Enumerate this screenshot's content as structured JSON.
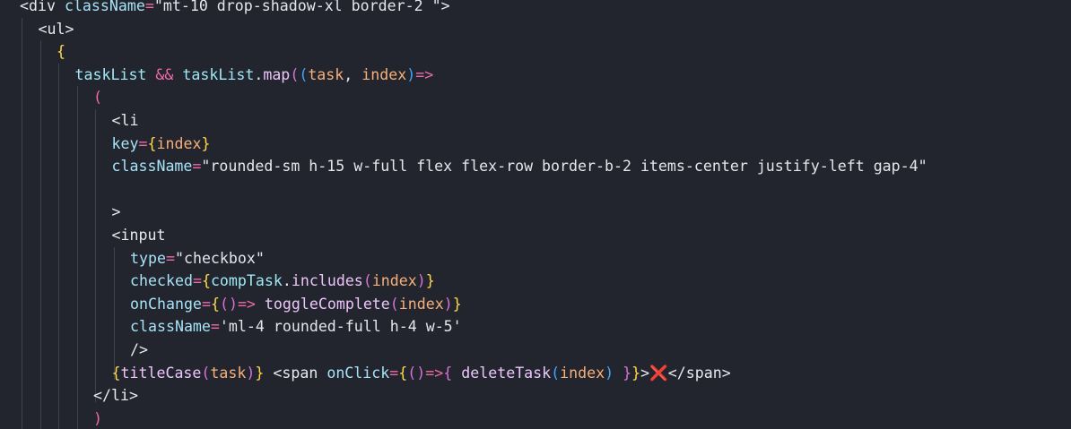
{
  "editor": {
    "colors": {
      "background": "#22252e",
      "default": "#e7e9ee",
      "tag": "#e7e9ee",
      "attr": "#a6e3f7",
      "string": "#e3e7ec",
      "operator": "#f06aa8",
      "identifier": "#9fe8f6",
      "function": "#ecc6fb",
      "param": "#f6b07a",
      "bracket1": "#ffd84a",
      "bracket2": "#da70d6",
      "bracket3": "#3fa6ff",
      "cross": "#e5213a",
      "guide": "#3e424c"
    },
    "lines": [
      {
        "indent": 0,
        "tokens": [
          {
            "t": "<div ",
            "c": "tag"
          },
          {
            "t": "className",
            "c": "attr"
          },
          {
            "t": "=",
            "c": "operator"
          },
          {
            "t": "\"mt-10 drop-shadow-xl border-2 \"",
            "c": "string"
          },
          {
            "t": ">",
            "c": "tag"
          }
        ]
      },
      {
        "indent": 2,
        "tokens": [
          {
            "t": "<ul>",
            "c": "tag"
          }
        ]
      },
      {
        "indent": 4,
        "tokens": [
          {
            "t": "{",
            "c": "bracket1"
          }
        ]
      },
      {
        "indent": 6,
        "tokens": [
          {
            "t": "taskList ",
            "c": "identifier"
          },
          {
            "t": "&&",
            "c": "operator"
          },
          {
            "t": " taskList",
            "c": "identifier"
          },
          {
            "t": ".",
            "c": "default"
          },
          {
            "t": "map",
            "c": "function"
          },
          {
            "t": "(",
            "c": "bracket2"
          },
          {
            "t": "(",
            "c": "bracket3"
          },
          {
            "t": "task",
            "c": "param"
          },
          {
            "t": ", ",
            "c": "default"
          },
          {
            "t": "index",
            "c": "param"
          },
          {
            "t": ")",
            "c": "bracket3"
          },
          {
            "t": "=>",
            "c": "operator"
          }
        ]
      },
      {
        "indent": 8,
        "tokens": [
          {
            "t": "(",
            "c": "operator"
          }
        ]
      },
      {
        "indent": 10,
        "tokens": [
          {
            "t": "<li",
            "c": "tag"
          }
        ]
      },
      {
        "indent": 10,
        "tokens": [
          {
            "t": "key",
            "c": "attr"
          },
          {
            "t": "=",
            "c": "operator"
          },
          {
            "t": "{",
            "c": "bracket1"
          },
          {
            "t": "index",
            "c": "param"
          },
          {
            "t": "}",
            "c": "bracket1"
          }
        ]
      },
      {
        "indent": 10,
        "tokens": [
          {
            "t": "className",
            "c": "attr"
          },
          {
            "t": "=",
            "c": "operator"
          },
          {
            "t": "\"rounded-sm h-15 w-full flex flex-row border-b-2 items-center justify-left gap-4\"",
            "c": "string"
          }
        ]
      },
      {
        "indent": 10,
        "tokens": []
      },
      {
        "indent": 10,
        "tokens": [
          {
            "t": ">",
            "c": "tag"
          }
        ]
      },
      {
        "indent": 10,
        "tokens": [
          {
            "t": "<input",
            "c": "tag"
          }
        ]
      },
      {
        "indent": 12,
        "tokens": [
          {
            "t": "type",
            "c": "attr"
          },
          {
            "t": "=",
            "c": "operator"
          },
          {
            "t": "\"checkbox\"",
            "c": "string"
          }
        ]
      },
      {
        "indent": 12,
        "tokens": [
          {
            "t": "checked",
            "c": "attr"
          },
          {
            "t": "=",
            "c": "operator"
          },
          {
            "t": "{",
            "c": "bracket1"
          },
          {
            "t": "compTask",
            "c": "identifier"
          },
          {
            "t": ".",
            "c": "default"
          },
          {
            "t": "includes",
            "c": "function"
          },
          {
            "t": "(",
            "c": "bracket2"
          },
          {
            "t": "index",
            "c": "param"
          },
          {
            "t": ")",
            "c": "bracket2"
          },
          {
            "t": "}",
            "c": "bracket1"
          }
        ]
      },
      {
        "indent": 12,
        "tokens": [
          {
            "t": "onChange",
            "c": "attr"
          },
          {
            "t": "=",
            "c": "operator"
          },
          {
            "t": "{",
            "c": "bracket1"
          },
          {
            "t": "(",
            "c": "bracket2"
          },
          {
            "t": ")",
            "c": "bracket2"
          },
          {
            "t": "=>",
            "c": "operator"
          },
          {
            "t": " ",
            "c": "default"
          },
          {
            "t": "toggleComplete",
            "c": "function"
          },
          {
            "t": "(",
            "c": "bracket2"
          },
          {
            "t": "index",
            "c": "param"
          },
          {
            "t": ")",
            "c": "bracket2"
          },
          {
            "t": "}",
            "c": "bracket1"
          }
        ]
      },
      {
        "indent": 12,
        "tokens": [
          {
            "t": "className",
            "c": "attr"
          },
          {
            "t": "=",
            "c": "operator"
          },
          {
            "t": "'ml-4 rounded-full h-4 w-5'",
            "c": "string"
          }
        ]
      },
      {
        "indent": 12,
        "tokens": [
          {
            "t": "/>",
            "c": "tag"
          }
        ]
      },
      {
        "indent": 10,
        "tokens": [
          {
            "t": "{",
            "c": "bracket1"
          },
          {
            "t": "titleCase",
            "c": "function"
          },
          {
            "t": "(",
            "c": "bracket2"
          },
          {
            "t": "task",
            "c": "param"
          },
          {
            "t": ")",
            "c": "bracket2"
          },
          {
            "t": "}",
            "c": "bracket1"
          },
          {
            "t": " <span ",
            "c": "tag"
          },
          {
            "t": "onClick",
            "c": "attr"
          },
          {
            "t": "=",
            "c": "operator"
          },
          {
            "t": "{",
            "c": "bracket1"
          },
          {
            "t": "(",
            "c": "bracket2"
          },
          {
            "t": ")",
            "c": "bracket2"
          },
          {
            "t": "=>",
            "c": "operator"
          },
          {
            "t": "{",
            "c": "bracket2"
          },
          {
            "t": " ",
            "c": "default"
          },
          {
            "t": "deleteTask",
            "c": "function"
          },
          {
            "t": "(",
            "c": "bracket3"
          },
          {
            "t": "index",
            "c": "param"
          },
          {
            "t": ")",
            "c": "bracket3"
          },
          {
            "t": " ",
            "c": "default"
          },
          {
            "t": "}",
            "c": "bracket2"
          },
          {
            "t": "}",
            "c": "bracket1"
          },
          {
            "t": ">",
            "c": "tag"
          },
          {
            "t": "❌",
            "c": "cross"
          },
          {
            "t": "</span>",
            "c": "tag"
          }
        ]
      },
      {
        "indent": 8,
        "tokens": [
          {
            "t": "</li>",
            "c": "tag"
          }
        ]
      },
      {
        "indent": 8,
        "tokens": [
          {
            "t": ")",
            "c": "operator"
          }
        ]
      }
    ]
  }
}
